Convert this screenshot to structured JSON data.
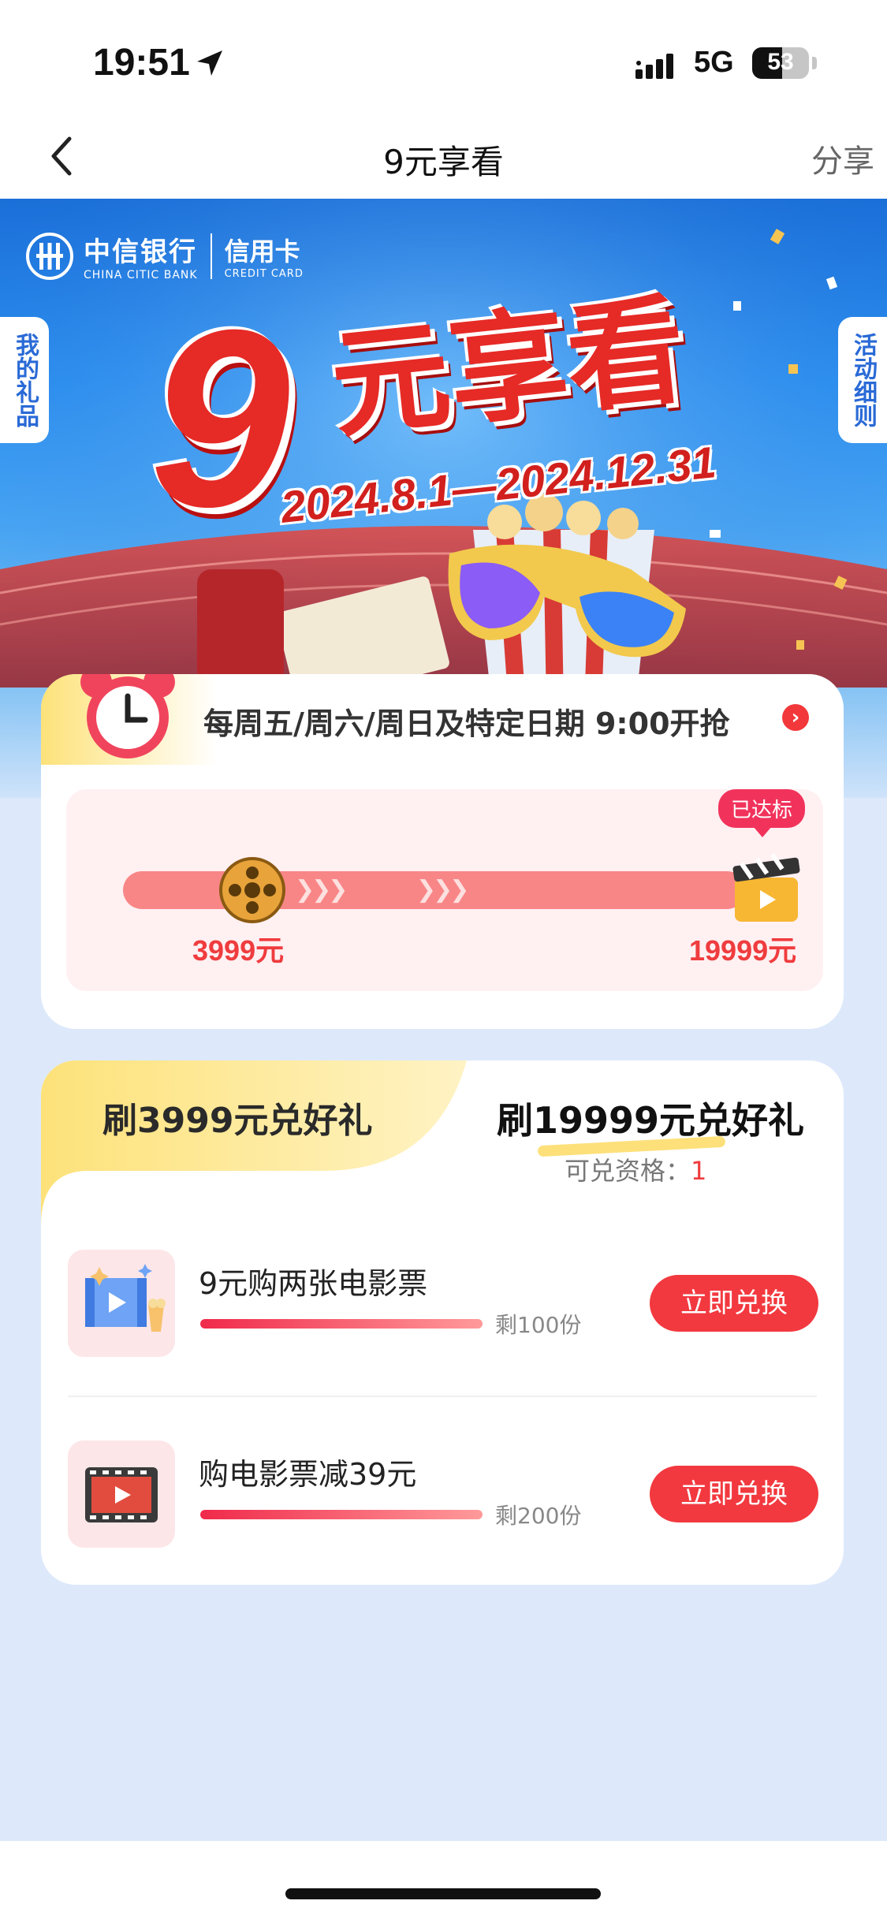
{
  "status": {
    "time": "19:51",
    "network": "5G",
    "battery": "53",
    "battery_level": 0.53
  },
  "nav": {
    "title": "9元享看",
    "share": "分享"
  },
  "banner": {
    "bank_cn": "中信银行",
    "bank_en": "CHINA CITIC BANK",
    "card_cn": "信用卡",
    "card_en": "CREDIT CARD",
    "headline_num": "9",
    "headline_text": "元享看",
    "dates": "2024.8.1—2024.12.31",
    "left_tab": "我的礼品",
    "right_tab": "活动细则"
  },
  "schedule": {
    "text": "每周五/周六/周日及特定日期 9:00开抢"
  },
  "progress": {
    "reached_badge": "已达标",
    "start_amount": "3999元",
    "end_amount": "19999元"
  },
  "rewards": {
    "tab_left": "刷3999元兑好礼",
    "tab_right": "刷19999元兑好礼",
    "eligibility_label": "可兑资格：",
    "eligibility_value": "1",
    "items": [
      {
        "name": "9元购两张电影票",
        "remaining": "剩100份",
        "button": "立即兑换"
      },
      {
        "name": "购电影票减39元",
        "remaining": "剩200份",
        "button": "立即兑换"
      }
    ]
  }
}
